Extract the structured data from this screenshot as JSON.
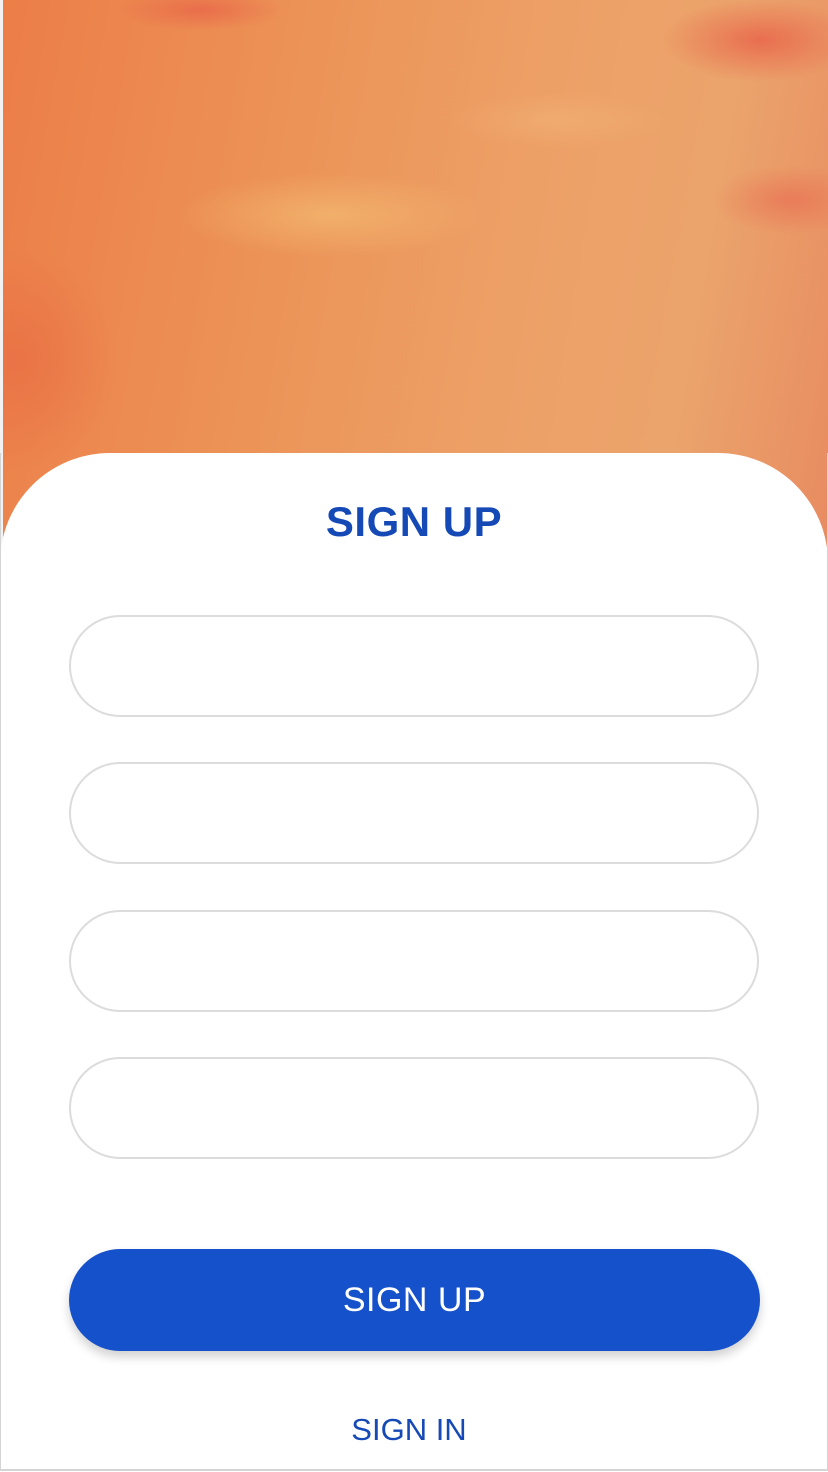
{
  "hero": {
    "description_icon": "sunset-sky-background"
  },
  "form": {
    "title": "SIGN UP",
    "fields": [
      {
        "placeholder": "",
        "value": ""
      },
      {
        "placeholder": "",
        "value": ""
      },
      {
        "placeholder": "",
        "value": ""
      },
      {
        "placeholder": "",
        "value": ""
      }
    ],
    "submit_label": "SIGN UP",
    "signin_link": "SIGN IN"
  },
  "colors": {
    "accent": "#1651cc",
    "title": "#1549b6",
    "field_border": "#dcdcdc",
    "background": "#ffffff",
    "sky_orange": "#eda066"
  }
}
